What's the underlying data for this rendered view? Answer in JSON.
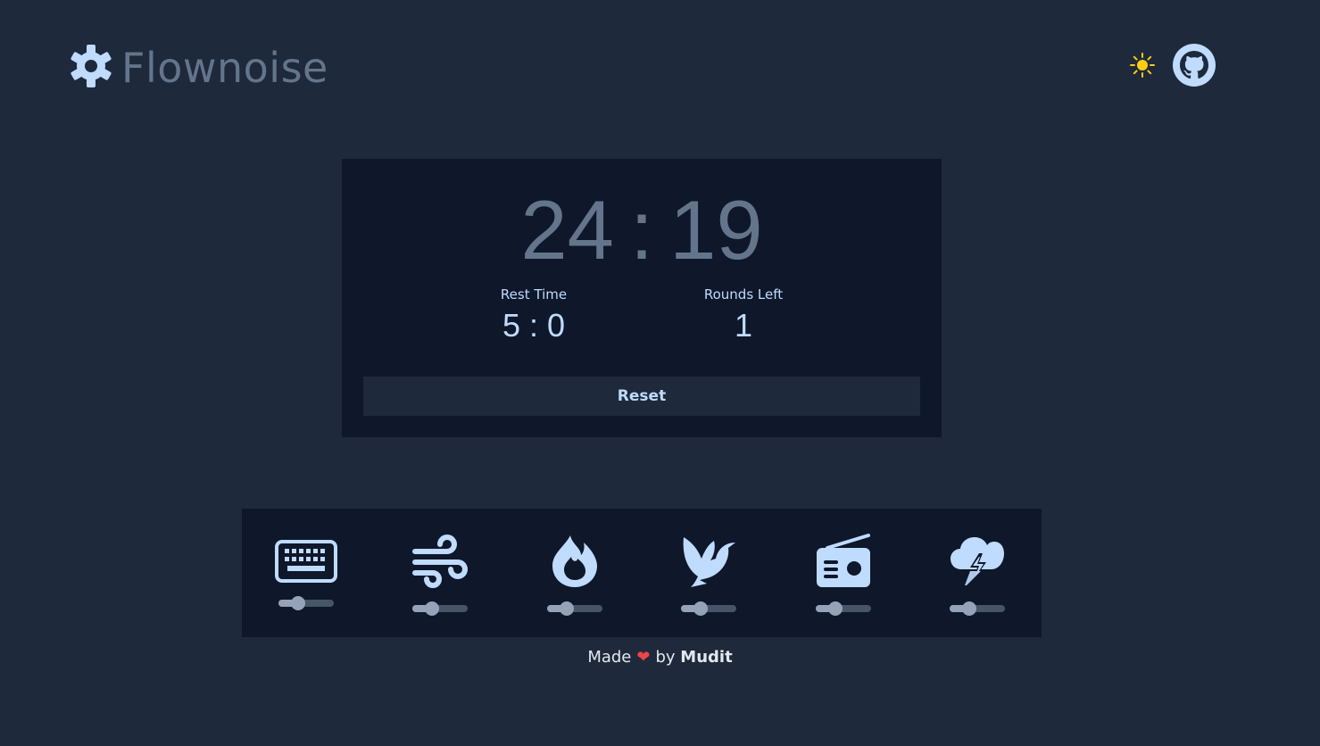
{
  "header": {
    "title": "Flownoise",
    "logo_icon": "gear-icon",
    "theme_toggle_icon": "sun-icon",
    "github_icon": "github-icon"
  },
  "timer": {
    "minutes": "24",
    "separator": ":",
    "seconds": "19",
    "rest_label": "Rest Time",
    "rest_value": "5 : 0",
    "rounds_label": "Rounds Left",
    "rounds_value": "1",
    "reset_label": "Reset"
  },
  "sounds": [
    {
      "icon": "keyboard-icon",
      "volume": 0.35
    },
    {
      "icon": "wind-icon",
      "volume": 0.35
    },
    {
      "icon": "fire-icon",
      "volume": 0.35
    },
    {
      "icon": "bird-icon",
      "volume": 0.35
    },
    {
      "icon": "radio-icon",
      "volume": 0.35
    },
    {
      "icon": "thunderstorm-icon",
      "volume": 0.35
    }
  ],
  "footer": {
    "made": "Made",
    "by": "by",
    "author": "Mudit"
  },
  "colors": {
    "background": "#1e293b",
    "card": "#0f172a",
    "accent": "#bfdbfe",
    "muted": "#64748b",
    "sun": "#facc15",
    "heart": "#ef4444"
  }
}
